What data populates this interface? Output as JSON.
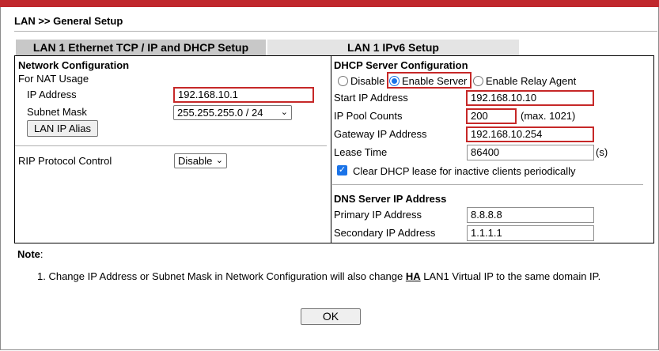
{
  "page": {
    "title": "LAN >> General Setup",
    "accent_color": "#c0282d",
    "highlight_color": "#c62828"
  },
  "tabs": [
    {
      "label": "LAN 1 Ethernet TCP / IP and DHCP Setup",
      "active": true
    },
    {
      "label": "LAN 1 IPv6 Setup",
      "active": false
    }
  ],
  "network": {
    "heading": "Network Configuration",
    "subheading": "For NAT Usage",
    "ip_label": "IP Address",
    "ip_value": "192.168.10.1",
    "mask_label": "Subnet Mask",
    "mask_value": "255.255.255.0 / 24",
    "alias_button": "LAN IP Alias",
    "rip_label": "RIP Protocol Control",
    "rip_value": "Disable"
  },
  "dhcp": {
    "heading": "DHCP Server Configuration",
    "modes": [
      {
        "label": "Disable",
        "selected": false
      },
      {
        "label": "Enable Server",
        "selected": true
      },
      {
        "label": "Enable Relay Agent",
        "selected": false
      }
    ],
    "start_label": "Start IP Address",
    "start_value": "192.168.10.10",
    "pool_label": "IP Pool Counts",
    "pool_value": "200",
    "pool_hint": "(max. 1021)",
    "gateway_label": "Gateway IP Address",
    "gateway_value": "192.168.10.254",
    "lease_label": "Lease Time",
    "lease_value": "86400",
    "lease_unit": "(s)",
    "clear_label": "Clear DHCP lease for inactive clients periodically",
    "clear_checked": true
  },
  "dns": {
    "heading": "DNS Server IP Address",
    "primary_label": "Primary IP Address",
    "primary_value": "8.8.8.8",
    "secondary_label": "Secondary IP Address",
    "secondary_value": "1.1.1.1"
  },
  "note": {
    "heading": "Note",
    "colon": ":",
    "item_prefix": "1. Change IP Address or Subnet Mask in Network Configuration will also change ",
    "item_ha": "HA",
    "item_suffix": " LAN1 Virtual IP to the same domain IP."
  },
  "ok_button": "OK"
}
